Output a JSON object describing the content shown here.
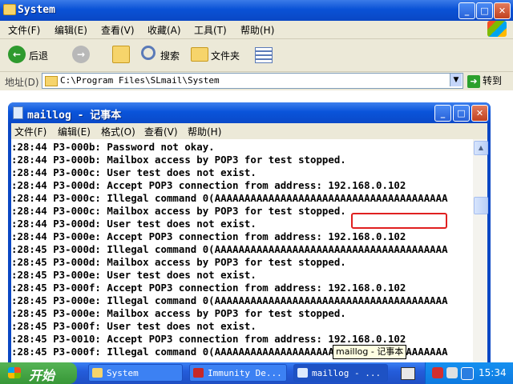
{
  "explorer": {
    "title": "System",
    "menu": [
      "文件(F)",
      "编辑(E)",
      "查看(V)",
      "收藏(A)",
      "工具(T)",
      "帮助(H)"
    ],
    "toolbar": {
      "back": "后退",
      "search": "搜索",
      "folders": "文件夹"
    },
    "address_label": "地址(D)",
    "address_value": "C:\\Program Files\\SLmail\\System",
    "go_label": "转到"
  },
  "notepad": {
    "title": "maillog - 记事本",
    "menu": [
      "文件(F)",
      "编辑(E)",
      "格式(O)",
      "查看(V)",
      "帮助(H)"
    ],
    "lines": [
      ":28:44 P3-000b: Password not okay.",
      ":28:44 P3-000b: Mailbox access by POP3 for test stopped.",
      ":28:44 P3-000c: User test does not exist.",
      ":28:44 P3-000d: Accept POP3 connection from address: 192.168.0.102",
      ":28:44 P3-000c: Illegal command 0(AAAAAAAAAAAAAAAAAAAAAAAAAAAAAAAAAAAAAAA",
      ":28:44 P3-000c: Mailbox access by POP3 for test stopped.",
      ":28:44 P3-000d: User test does not exist.",
      ":28:44 P3-000e: Accept POP3 connection from address: 192.168.0.102",
      ":28:45 P3-000d: Illegal command 0(AAAAAAAAAAAAAAAAAAAAAAAAAAAAAAAAAAAAAAA",
      ":28:45 P3-000d: Mailbox access by POP3 for test stopped.",
      ":28:45 P3-000e: User test does not exist.",
      ":28:45 P3-000f: Accept POP3 connection from address: 192.168.0.102",
      ":28:45 P3-000e: Illegal command 0(AAAAAAAAAAAAAAAAAAAAAAAAAAAAAAAAAAAAAAA",
      ":28:45 P3-000e: Mailbox access by POP3 for test stopped.",
      ":28:45 P3-000f: User test does not exist.",
      ":28:45 P3-0010: Accept POP3 connection from address: 192.168.0.102",
      ":28:45 P3-000f: Illegal command 0(AAAAAAAAAAAAAAAAAAAAAAAAAAAAAAAAAAAAAAA"
    ],
    "highlight_color": "#E02020",
    "tooltip": "maillog - 记事本"
  },
  "taskbar": {
    "start_label": "开始",
    "tasks": [
      "System",
      "Immunity De...",
      "maillog - ..."
    ],
    "clock": "15:34"
  }
}
